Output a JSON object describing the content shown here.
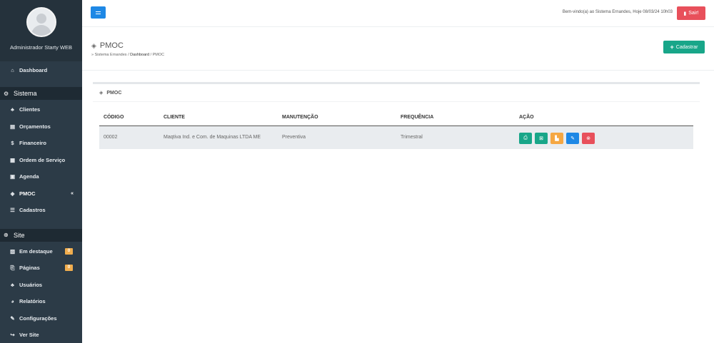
{
  "sidebar": {
    "profile_name": "Administrador Starty WEB",
    "dashboard": {
      "label": "Dashboard",
      "icon": "home-icon"
    },
    "sistema_section": "Sistema",
    "sistema_items": [
      {
        "label": "Clientes",
        "icon": "users-icon"
      },
      {
        "label": "Orçamentos",
        "icon": "file-icon"
      },
      {
        "label": "Financeiro",
        "icon": "money-icon"
      },
      {
        "label": "Ordem de Serviço",
        "icon": "list-icon"
      },
      {
        "label": "Agenda",
        "icon": "calendar-icon"
      },
      {
        "label": "PMOC",
        "icon": "layers-icon",
        "active": true
      },
      {
        "label": "Cadastros",
        "icon": "list-ul-icon"
      }
    ],
    "site_section": "Site",
    "site_items": [
      {
        "label": "Em destaque",
        "icon": "image-icon",
        "badge": "0"
      },
      {
        "label": "Páginas",
        "icon": "pages-icon",
        "badge": "0"
      },
      {
        "label": "Usuários",
        "icon": "users-icon"
      },
      {
        "label": "Relatórios",
        "icon": "pie-icon"
      },
      {
        "label": "Configurações",
        "icon": "wrench-icon"
      },
      {
        "label": "Ver Site",
        "icon": "share-icon"
      }
    ]
  },
  "topbar": {
    "welcome": "Bem-vindo(a) ao Sistema Ernandes, Hoje 08/03/24 10h03",
    "logout_label": "Sair!"
  },
  "page": {
    "title": "PMOC",
    "breadcrumb_root": "» Sistema Ernandes",
    "breadcrumb_mid": "Dashboard",
    "breadcrumb_current": "PMOC",
    "add_label": "Cadastrar"
  },
  "card": {
    "title": "PMOC",
    "columns": [
      "CÓDIGO",
      "CLIENTE",
      "MANUTENÇÃO",
      "FREQUÊNCIA",
      "AÇÃO"
    ],
    "rows": [
      {
        "codigo": "00002",
        "cliente": "Maqtiva Ind. e Com. de Maquinas LTDA ME",
        "manutencao": "Preventiva",
        "frequencia": "Trimestral"
      }
    ]
  },
  "colors": {
    "sidebar_bg": "#2c3b47",
    "primary": "#1e88e5",
    "success": "#18a689",
    "danger": "#e8505b",
    "warning": "#f5a742"
  }
}
